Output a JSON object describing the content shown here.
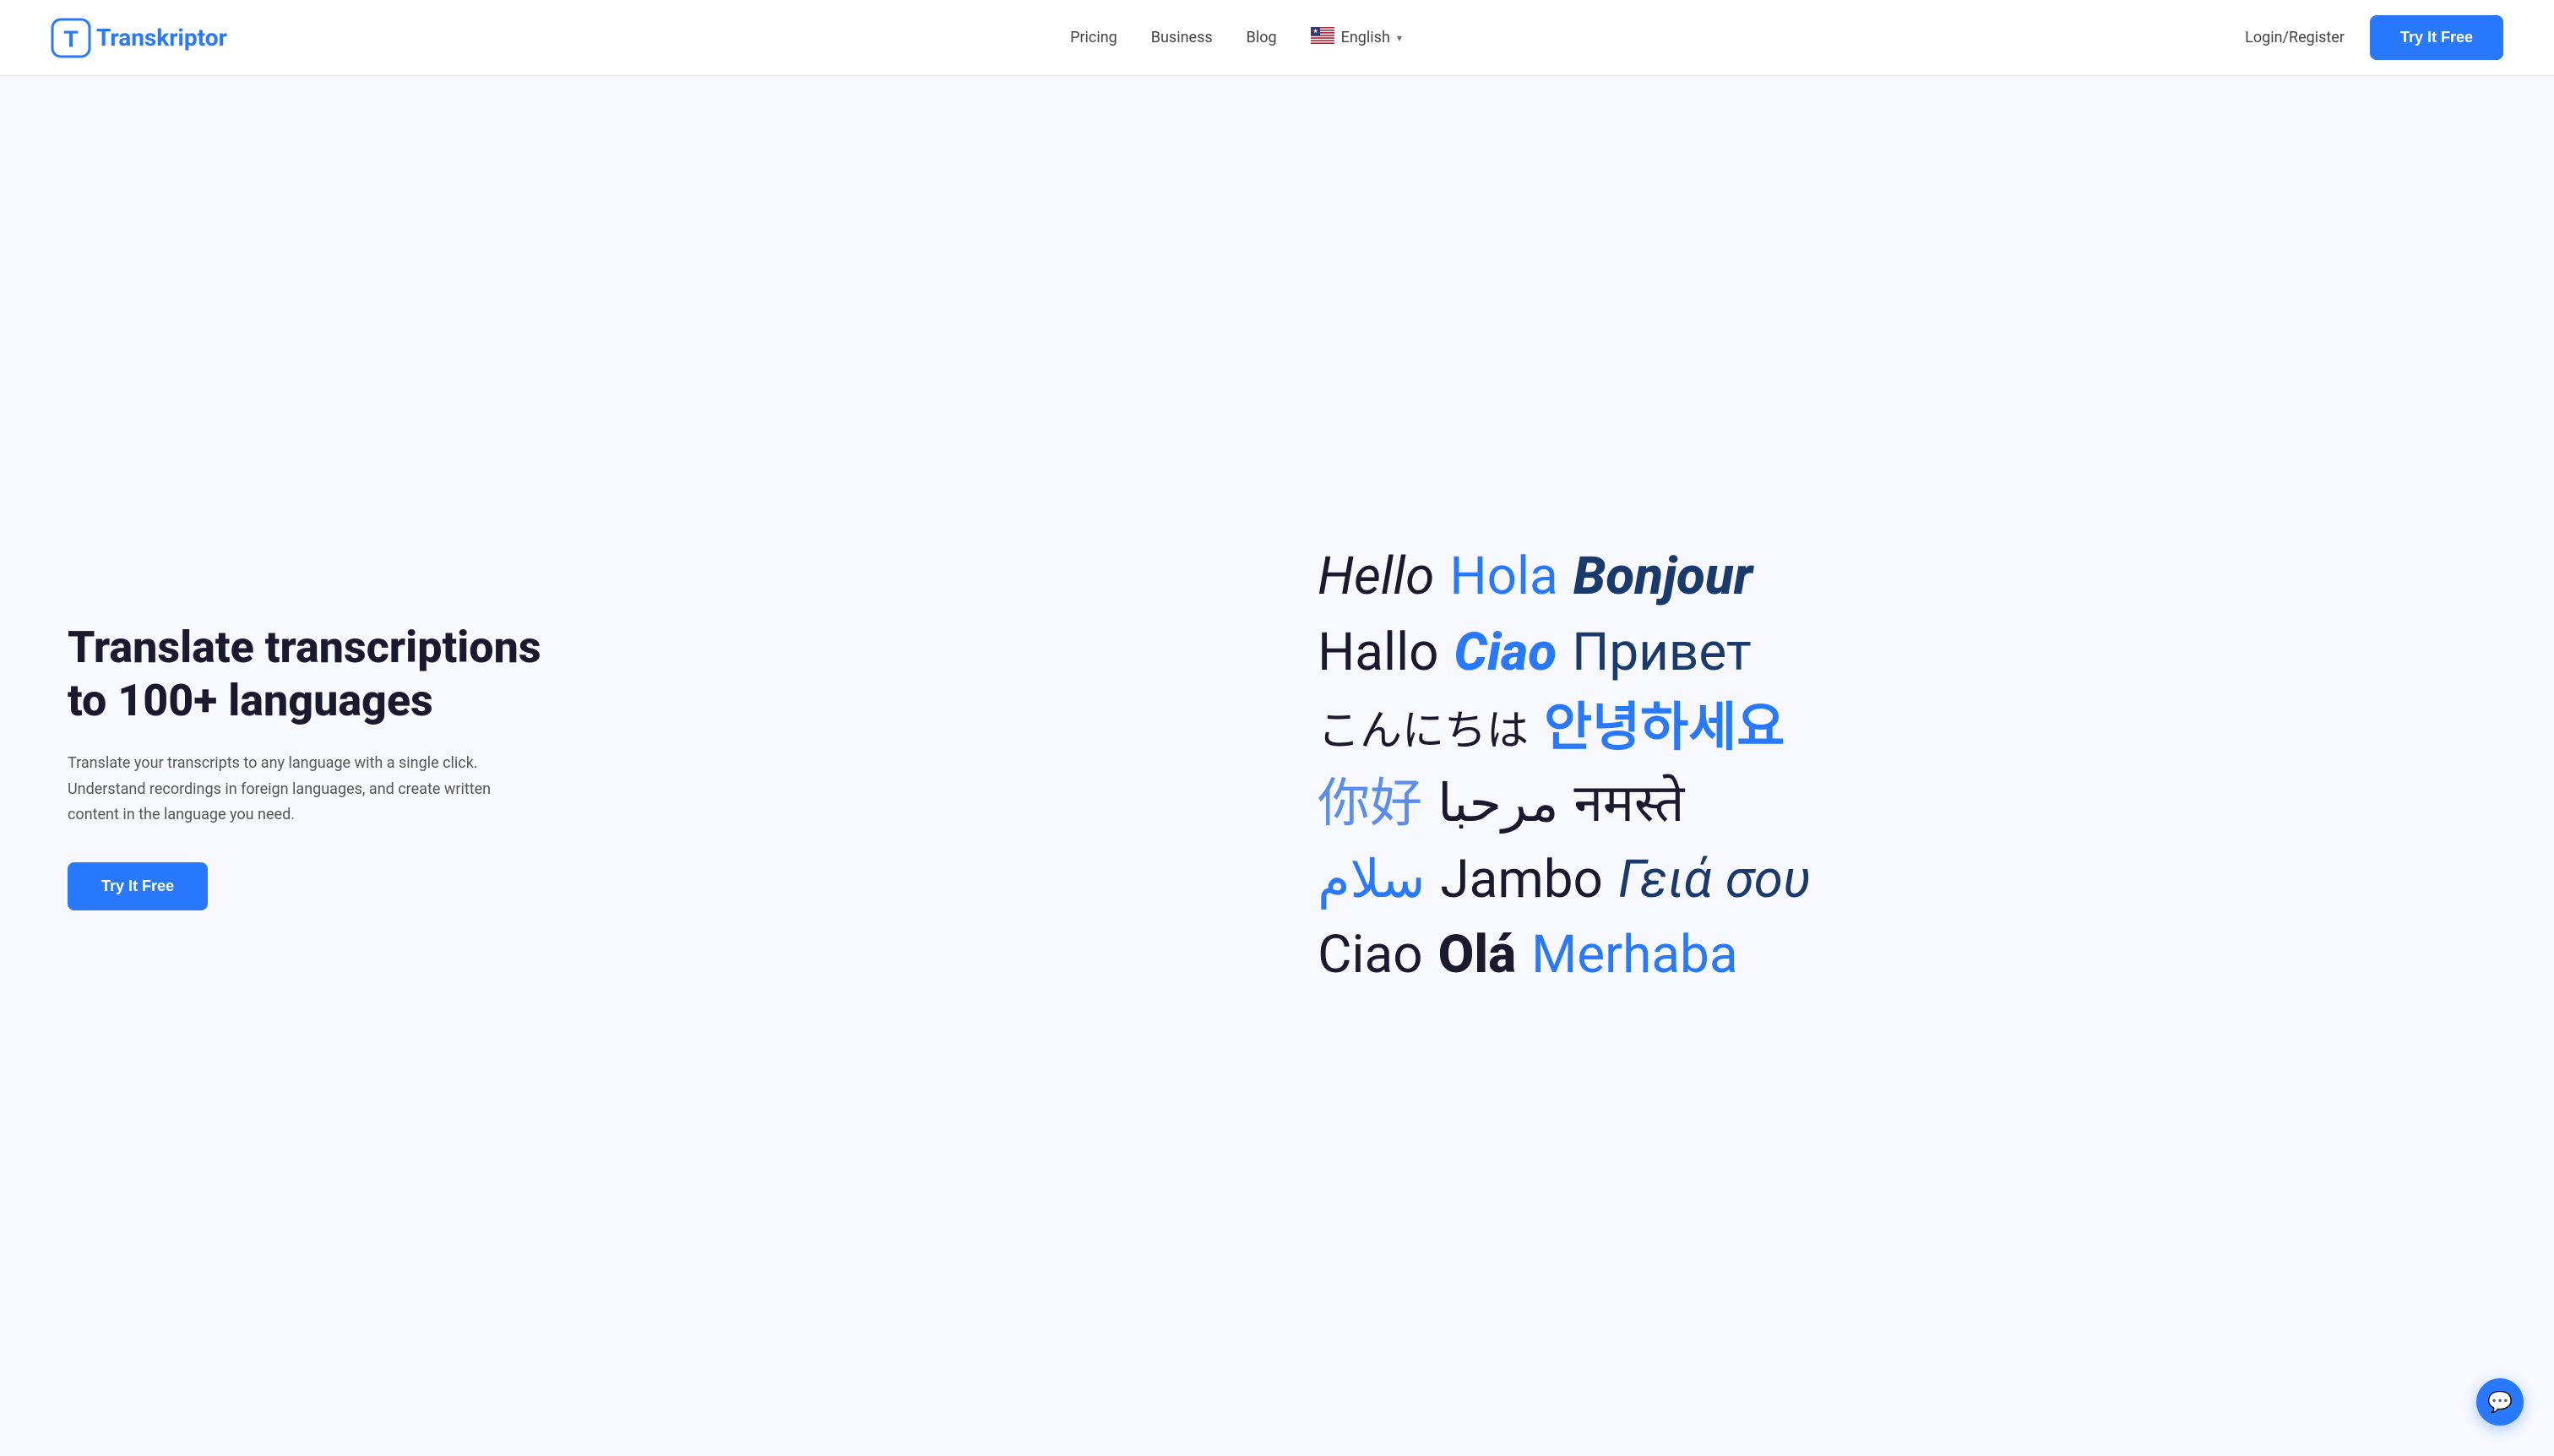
{
  "navbar": {
    "logo_text": "Transkriptor",
    "nav_links": [
      {
        "label": "Pricing",
        "id": "pricing"
      },
      {
        "label": "Business",
        "id": "business"
      },
      {
        "label": "Blog",
        "id": "blog"
      }
    ],
    "language": {
      "label": "English",
      "flag_emoji": "🇺🇸"
    },
    "login_label": "Login/Register",
    "try_free_label": "Try It Free"
  },
  "hero": {
    "title": "Translate transcriptions to 100+ languages",
    "description": "Translate your transcripts to any language with a single click. Understand recordings in foreign languages, and create written content in the language you need.",
    "cta_label": "Try It Free",
    "language_words": [
      {
        "text": "Hello",
        "style": "dark italic",
        "size": "lg"
      },
      {
        "text": "Hola",
        "style": "blue normal",
        "size": "lg"
      },
      {
        "text": "Bonjour",
        "style": "navy italic bold",
        "size": "lg"
      },
      {
        "text": "Hallo",
        "style": "dark normal",
        "size": "lg"
      },
      {
        "text": "Ciao",
        "style": "blue italic bold",
        "size": "lg"
      },
      {
        "text": "Привет",
        "style": "navy normal",
        "size": "lg"
      },
      {
        "text": "こんにちは",
        "style": "dark normal",
        "size": "md"
      },
      {
        "text": "안녕하세요",
        "style": "blue normal",
        "size": "lg"
      },
      {
        "text": "你好",
        "style": "light normal",
        "size": "lg"
      },
      {
        "text": "مرحبا",
        "style": "dark normal",
        "size": "lg"
      },
      {
        "text": "नमस्ते",
        "style": "dark normal",
        "size": "lg"
      },
      {
        "text": "سلام",
        "style": "blue normal",
        "size": "lg"
      },
      {
        "text": "Jambo",
        "style": "dark normal",
        "size": "lg"
      },
      {
        "text": "Γειά σου",
        "style": "navy italic",
        "size": "lg"
      },
      {
        "text": "Ciao",
        "style": "dark normal",
        "size": "lg"
      },
      {
        "text": "Olá",
        "style": "dark bold",
        "size": "lg"
      },
      {
        "text": "Merhaba",
        "style": "blue normal",
        "size": "lg"
      }
    ]
  },
  "chat": {
    "icon": "💬"
  }
}
